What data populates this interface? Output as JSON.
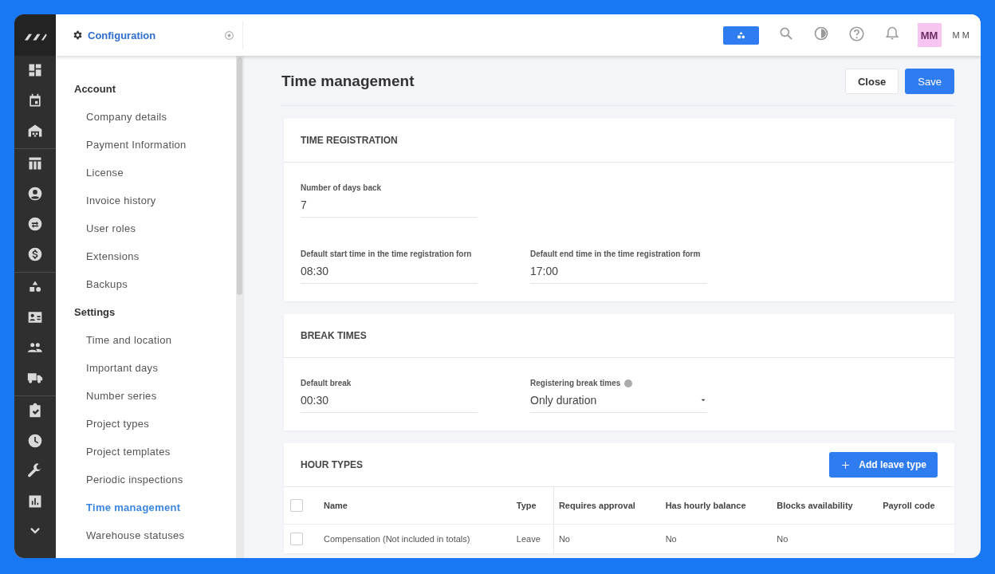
{
  "header": {
    "section_title": "Configuration",
    "avatar": "MM",
    "user_name": "M M"
  },
  "sidebar": {
    "groups": [
      {
        "title": "Account",
        "items": [
          {
            "label": "Company details",
            "selected": false
          },
          {
            "label": "Payment Information",
            "selected": false
          },
          {
            "label": "License",
            "selected": false
          },
          {
            "label": "Invoice history",
            "selected": false
          },
          {
            "label": "User roles",
            "selected": false
          },
          {
            "label": "Extensions",
            "selected": false
          },
          {
            "label": "Backups",
            "selected": false
          }
        ]
      },
      {
        "title": "Settings",
        "items": [
          {
            "label": "Time and location",
            "selected": false
          },
          {
            "label": "Important days",
            "selected": false
          },
          {
            "label": "Number series",
            "selected": false
          },
          {
            "label": "Project types",
            "selected": false
          },
          {
            "label": "Project templates",
            "selected": false
          },
          {
            "label": "Periodic inspections",
            "selected": false
          },
          {
            "label": "Time management",
            "selected": true
          },
          {
            "label": "Warehouse statuses",
            "selected": false
          }
        ]
      }
    ]
  },
  "page": {
    "title": "Time management",
    "buttons": [
      {
        "label": "Close",
        "kind": "secondary"
      },
      {
        "label": "Save",
        "kind": "primary"
      }
    ]
  },
  "sections": [
    {
      "title": "TIME REGISTRATION",
      "rows": [
        [
          {
            "label": "Number of days back",
            "value": "7",
            "kind": "text"
          }
        ],
        [
          {
            "label": "Default start time in the time registration forn",
            "value": "08:30",
            "kind": "text"
          },
          {
            "label": "Default end time in the time registration form",
            "value": "17:00",
            "kind": "text"
          }
        ]
      ]
    },
    {
      "title": "BREAK TIMES",
      "rows": [
        [
          {
            "label": "Default break",
            "value": "00:30",
            "kind": "text"
          },
          {
            "label": "Registering break times",
            "value": "Only duration",
            "kind": "select",
            "info": true
          }
        ]
      ]
    }
  ],
  "hour_types": {
    "title": "HOUR TYPES",
    "action": "Add leave type",
    "header_checked": false,
    "columns": [
      "Name",
      "Type",
      "Requires approval",
      "Has hourly balance",
      "Blocks availability",
      "Payroll code"
    ],
    "rows": [
      {
        "checked": false,
        "cells": [
          "Compensation (Not included in totals)",
          "Leave",
          "No",
          "No",
          "No"
        ]
      }
    ]
  }
}
